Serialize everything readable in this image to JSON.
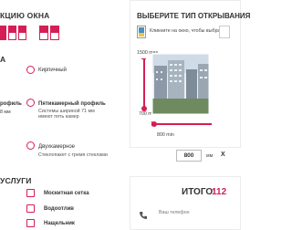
{
  "left": {
    "config_heading": "КЦИЮ ОКНА",
    "profile_heading": "А",
    "brick_label": "Кирпичный",
    "profile_left": "рофиль",
    "profile_left_sub": "8 мм",
    "five_chamber_title": "Пятикамерный профиль",
    "five_chamber_desc": "Системы шириной 71 мм имеют пять камер",
    "double_glazing_title": "Двухкамерное",
    "double_glazing_desc": "Стеклопакет с тремя стеклами",
    "services_heading": "УСЛУГИ",
    "services": [
      "Москитная сетка",
      "Водоотлив",
      "Нащельник"
    ]
  },
  "right": {
    "opening_heading": "ВЫБЕРИТЕ ТИП ОТКРЫВАНИЯ",
    "hint": "Кликните на окно, чтобы выбрать",
    "height_max": "1500 max",
    "height_min": "700 min",
    "width_min": "800 min",
    "width_value": "800",
    "unit": "мм",
    "times": "X",
    "total_label": "ИТОГО:",
    "total_value": "112",
    "phone_placeholder": "Ваш телефон"
  },
  "colors": {
    "accent": "#d51e56"
  }
}
